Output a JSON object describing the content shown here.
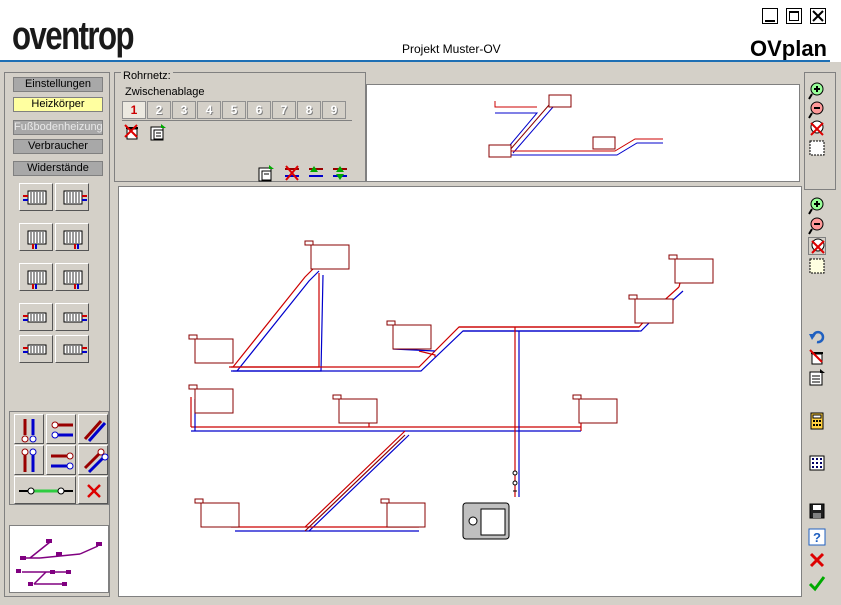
{
  "header": {
    "logo_text": "oventrop",
    "project_title": "Projekt Muster-OV",
    "app_title": "OVplan"
  },
  "categories": [
    {
      "label": "Einstellungen",
      "state": "normal"
    },
    {
      "label": "Heizkörper",
      "state": "active"
    },
    {
      "label": "Fußbodenheizung",
      "state": "disabled"
    },
    {
      "label": "Verbraucher",
      "state": "normal"
    },
    {
      "label": "Widerstände",
      "state": "normal"
    }
  ],
  "rohrnetz": {
    "label": "Rohrnetz:",
    "clipboard_label": "Zwischenablage",
    "tabs": [
      "1",
      "2",
      "3",
      "4",
      "5",
      "6",
      "7",
      "8",
      "9"
    ],
    "selected_tab": "1"
  },
  "icons": {
    "radiator_palette": [
      "radiator-side-connection-icon",
      "radiator-side-connection-right-icon",
      "radiator-bottom-connection-icon",
      "radiator-bottom-connection-center-icon",
      "radiator-bottom-left-icon",
      "radiator-bottom-right-icon",
      "radiator-flat-icon",
      "radiator-flat-alt-icon",
      "radiator-flat-low-icon",
      "radiator-flat-low-alt-icon"
    ],
    "pipe_tools": [
      "vertical-pipe-pair-icon",
      "horizontal-pipe-valve-icon",
      "diagonal-pipe-icon",
      "vertical-pipe-valves-icon",
      "horizontal-pipe-pair-icon",
      "diagonal-pipe-valves-icon",
      "pipe-connector-icon",
      "delete-pipe-icon"
    ],
    "right_toolbar": [
      "zoom-in-icon",
      "zoom-out-icon",
      "zoom-cancel-icon",
      "zoom-fit-icon",
      "zoom-in-canvas-icon",
      "zoom-out-canvas-icon",
      "zoom-cancel-canvas-icon",
      "select-region-icon",
      "undo-icon",
      "delete-icon",
      "properties-icon",
      "calculator-icon",
      "grid-icon",
      "save-icon",
      "help-icon",
      "cancel-icon",
      "ok-icon"
    ]
  },
  "colors": {
    "accent_line": "#1e6fb4",
    "supply_pipe": "#cc0000",
    "return_pipe": "#0000cc",
    "active_category": "#ffffa0",
    "selected_tab": "#cc0000"
  }
}
